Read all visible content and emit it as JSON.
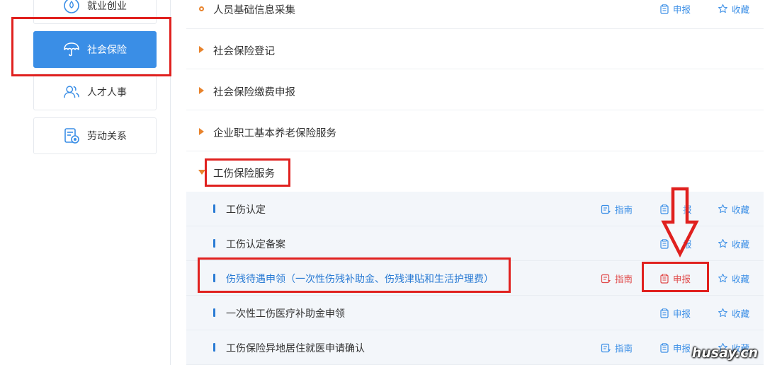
{
  "sidebar": {
    "items": [
      {
        "label": "就业创业",
        "icon": "drop-icon"
      },
      {
        "label": "社会保险",
        "icon": "umbrella-icon"
      },
      {
        "label": "人才人事",
        "icon": "people-icon"
      },
      {
        "label": "劳动关系",
        "icon": "contract-icon"
      }
    ]
  },
  "main": {
    "top_item": {
      "title": "人员基础信息采集",
      "declare": "申报",
      "favorite": "收藏"
    },
    "categories": [
      {
        "title": "社会保险登记"
      },
      {
        "title": "社会保险缴费申报"
      },
      {
        "title": "企业职工基本养老保险服务"
      },
      {
        "title": "工伤保险服务"
      }
    ],
    "sub_items": [
      {
        "title": "工伤认定",
        "guide": "指南",
        "declare": "报",
        "favorite": "收藏"
      },
      {
        "title": "工伤认定备案",
        "declare": "报",
        "favorite": "收藏"
      },
      {
        "title": "伤残待遇申领（一次性伤残补助金、伤残津贴和生活护理费）",
        "guide": "指南",
        "declare": "申报",
        "favorite": "收藏"
      },
      {
        "title": "一次性工伤医疗补助金申领",
        "declare": "申报",
        "favorite": "收藏"
      },
      {
        "title": "工伤保险异地居住就医申请确认",
        "guide": "指南",
        "declare": "申报",
        "favorite": "收藏"
      }
    ]
  },
  "watermark": "husay.cn",
  "colors": {
    "accent": "#3a8ee6",
    "annotation_red": "#e0211f",
    "triangle_orange": "#e8832c"
  }
}
